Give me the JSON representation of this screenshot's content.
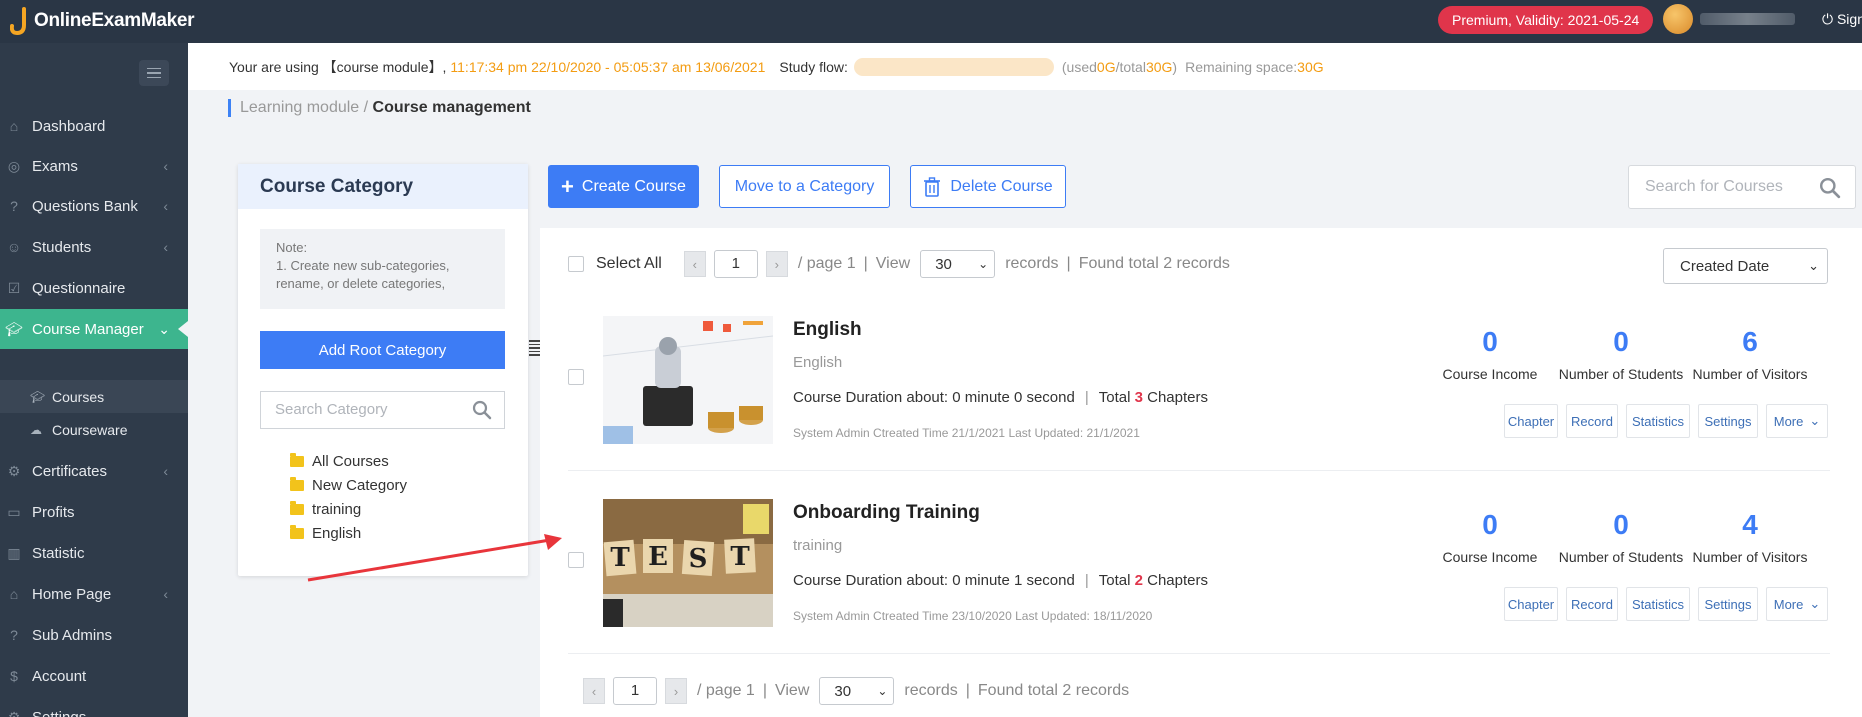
{
  "topbar": {
    "logo_text": "OnlineExamMaker",
    "premium_badge": "Premium, Validity: 2021-05-24",
    "signout_label": "Sign out"
  },
  "sidebar": {
    "items": [
      {
        "label": "Dashboard",
        "icon": "home-icon"
      },
      {
        "label": "Exams",
        "icon": "check-circle-icon"
      },
      {
        "label": "Questions Bank",
        "icon": "question-icon"
      },
      {
        "label": "Students",
        "icon": "user-icon"
      },
      {
        "label": "Questionnaire",
        "icon": "checkbox-icon"
      },
      {
        "label": "Course Manager",
        "icon": "graduation-cap-icon"
      },
      {
        "label": "Certificates",
        "icon": "gear-icon"
      },
      {
        "label": "Profits",
        "icon": "card-icon"
      },
      {
        "label": "Statistic",
        "icon": "bar-chart-icon"
      },
      {
        "label": "Home Page",
        "icon": "house-icon"
      },
      {
        "label": "Sub Admins",
        "icon": "question-icon"
      },
      {
        "label": "Account",
        "icon": "dollar-icon"
      },
      {
        "label": "Settings",
        "icon": "gear-icon"
      }
    ],
    "sub_items": [
      {
        "label": "Courses"
      },
      {
        "label": "Courseware"
      }
    ]
  },
  "infobar": {
    "using_prefix": "Your are using 【course module】, ",
    "validity_range": "11:17:34 pm 22/10/2020 - 05:05:37 am 13/06/2021",
    "study_flow_label": "Study flow:",
    "used_prefix": "(used ",
    "used_value": "0G",
    "total_prefix": "/total ",
    "total_value": "30G",
    "close_paren": ")",
    "remaining_label": "Remaining space: ",
    "remaining_value": "30G"
  },
  "breadcrumb": {
    "parent": "Learning module / ",
    "current": "Course management"
  },
  "category": {
    "title": "Course Category",
    "note_label": "Note:",
    "note_text": "1. Create new sub-categories, rename, or delete categories,",
    "add_root_label": "Add Root Category",
    "search_placeholder": "Search Category",
    "items": [
      "All Courses",
      "New Category",
      "training",
      "English"
    ]
  },
  "toolbar": {
    "create_label": "Create Course",
    "move_label": "Move to a Category",
    "delete_label": "Delete Course",
    "search_placeholder": "Search for Courses"
  },
  "list": {
    "select_all": "Select All",
    "page_value": "1",
    "page_text": "/ page 1",
    "view_label": "View",
    "per_page": "30",
    "records_label": "records",
    "found_text": "Found total 2 records",
    "sort_by": "Created Date",
    "courses": [
      {
        "title": "English",
        "category": "English",
        "duration": "Course Duration about: 0 minute 0 second",
        "total_label": "Total ",
        "chapters": "3",
        "chapters_suffix": " Chapters",
        "meta": "System Admin Ctreated Time 21/1/2021 Last Updated: 21/1/2021",
        "income": "0",
        "students": "0",
        "visitors": "6"
      },
      {
        "title": "Onboarding Training",
        "category": "training",
        "duration": "Course Duration about: 0 minute 1 second",
        "total_label": "Total ",
        "chapters": "2",
        "chapters_suffix": " Chapters",
        "meta": "System Admin Ctreated Time 23/10/2020 Last Updated: 18/11/2020",
        "income": "0",
        "students": "0",
        "visitors": "4"
      }
    ],
    "stat_labels": {
      "income": "Course Income",
      "students": "Number of Students",
      "visitors": "Number of Visitors"
    },
    "actions": {
      "chapter": "Chapter",
      "record": "Record",
      "statistics": "Statistics",
      "settings": "Settings",
      "more": "More"
    }
  },
  "colors": {
    "accent": "#3d7cf5",
    "sidebar_bg": "#2f3b4a",
    "active_green": "#3db58e",
    "badge_red": "#e0354b"
  }
}
